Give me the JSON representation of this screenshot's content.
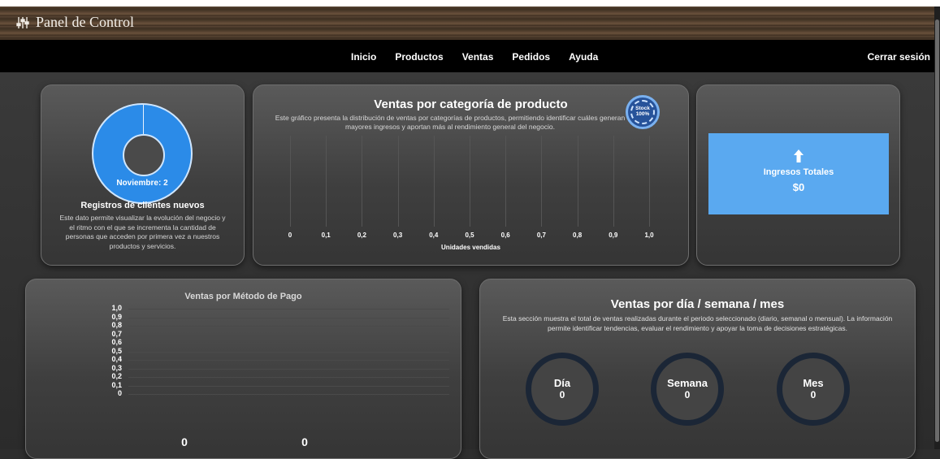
{
  "app": {
    "title": "Panel de Control"
  },
  "nav": {
    "items": [
      "Inicio",
      "Productos",
      "Ventas",
      "Pedidos",
      "Ayuda"
    ],
    "logout": "Cerrar sesión"
  },
  "clientes": {
    "donut_label": "Noviembre: 2",
    "title": "Registros de clientes nuevos",
    "description": "Este dato permite visualizar la evolución del negocio y el ritmo con el que se incrementa la cantidad de personas que acceden por primera vez a nuestros productos y servicios."
  },
  "categoria": {
    "title": "Ventas por categoría de producto",
    "description": "Este gráfico presenta la distribución de ventas por categorías de productos, permitiendo identificar cuáles generan mayores ingresos y aportan más al rendimiento general del negocio.",
    "stock_label": "Stock",
    "stock_value": "100%"
  },
  "ingresos": {
    "label": "Ingresos Totales",
    "value": "$0"
  },
  "periodo": {
    "title": "Ventas por día / semana / mes",
    "description": "Esta sección muestra el total de ventas realizadas durante el periodo seleccionado (diario, semanal o mensual). La información permite identificar tendencias, evaluar el rendimiento y apoyar la toma de decisiones estratégicas.",
    "dia_label": "Día",
    "dia_value": "0",
    "semana_label": "Semana",
    "semana_value": "0",
    "mes_label": "Mes",
    "mes_value": "0"
  },
  "colors": {
    "accent": "#2b8be8",
    "card_box": "#5aa9f0",
    "nav_bg": "#000000"
  },
  "chart_data": [
    {
      "type": "pie",
      "title": "",
      "categories": [
        "Noviembre"
      ],
      "values": [
        2
      ]
    },
    {
      "type": "bar",
      "title": "Ventas por categoría de producto",
      "xlabel": "Unidades vendidas",
      "ylabel": "",
      "tick_labels": [
        "0",
        "0,1",
        "0,2",
        "0,3",
        "0,4",
        "0,5",
        "0,6",
        "0,7",
        "0,8",
        "0,9",
        "1,0"
      ],
      "xlim": [
        0,
        1
      ],
      "categories": [],
      "values": [],
      "grid": true
    },
    {
      "type": "bar",
      "title": "Ventas por Método de Pago",
      "xlabel": "",
      "ylabel": "",
      "tick_labels": [
        "1,0",
        "0,9",
        "0,8",
        "0,7",
        "0,6",
        "0,5",
        "0,4",
        "0,3",
        "0,2",
        "0,1",
        "0"
      ],
      "ylim": [
        0,
        1
      ],
      "values": [
        0,
        0
      ],
      "grid": true
    }
  ]
}
